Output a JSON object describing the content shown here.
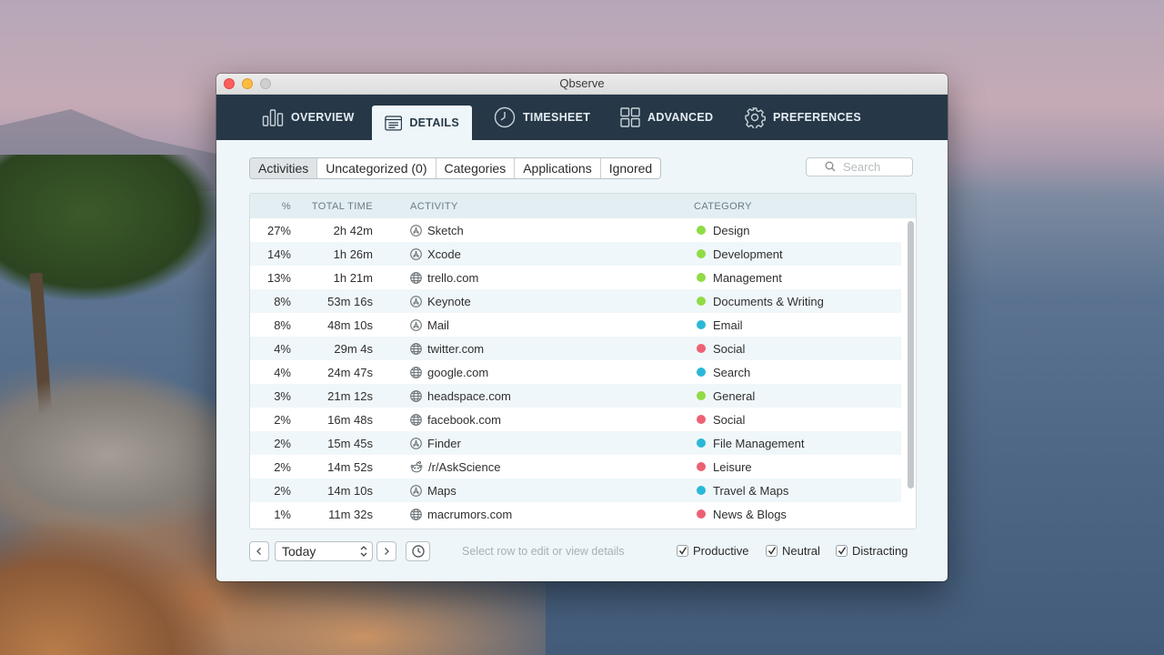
{
  "window": {
    "title": "Qbserve"
  },
  "tabs": [
    {
      "label": "OVERVIEW",
      "icon": "bar-chart-icon"
    },
    {
      "label": "DETAILS",
      "icon": "calendar-list-icon",
      "active": true
    },
    {
      "label": "TIMESHEET",
      "icon": "clock-icon"
    },
    {
      "label": "ADVANCED",
      "icon": "grid-icon"
    },
    {
      "label": "PREFERENCES",
      "icon": "gear-icon"
    }
  ],
  "filters": {
    "segments": [
      "Activities",
      "Uncategorized (0)",
      "Categories",
      "Applications",
      "Ignored"
    ],
    "selected": "Activities"
  },
  "search": {
    "placeholder": "Search",
    "value": ""
  },
  "table": {
    "headers": {
      "pct": "%",
      "time": "TOTAL TIME",
      "activity": "ACTIVITY",
      "category": "CATEGORY"
    },
    "rows": [
      {
        "pct": "27%",
        "time": "2h 42m",
        "activity": "Sketch",
        "icon": "app-store-icon",
        "category": "Design",
        "color": "#8fdc45"
      },
      {
        "pct": "14%",
        "time": "1h 26m",
        "activity": "Xcode",
        "icon": "app-store-icon",
        "category": "Development",
        "color": "#8fdc45"
      },
      {
        "pct": "13%",
        "time": "1h 21m",
        "activity": "trello.com",
        "icon": "globe-icon",
        "category": "Management",
        "color": "#8fdc45"
      },
      {
        "pct": "8%",
        "time": "53m 16s",
        "activity": "Keynote",
        "icon": "app-store-icon",
        "category": "Documents & Writing",
        "color": "#8fdc45"
      },
      {
        "pct": "8%",
        "time": "48m 10s",
        "activity": "Mail",
        "icon": "app-store-icon",
        "category": "Email",
        "color": "#2bb8d8"
      },
      {
        "pct": "4%",
        "time": "29m 4s",
        "activity": "twitter.com",
        "icon": "globe-icon",
        "category": "Social",
        "color": "#ec6274"
      },
      {
        "pct": "4%",
        "time": "24m 47s",
        "activity": "google.com",
        "icon": "globe-icon",
        "category": "Search",
        "color": "#2bb8d8"
      },
      {
        "pct": "3%",
        "time": "21m 12s",
        "activity": "headspace.com",
        "icon": "globe-icon",
        "category": "General",
        "color": "#8fdc45"
      },
      {
        "pct": "2%",
        "time": "16m 48s",
        "activity": "facebook.com",
        "icon": "globe-icon",
        "category": "Social",
        "color": "#ec6274"
      },
      {
        "pct": "2%",
        "time": "15m 45s",
        "activity": "Finder",
        "icon": "app-store-icon",
        "category": "File Management",
        "color": "#2bb8d8"
      },
      {
        "pct": "2%",
        "time": "14m 52s",
        "activity": "/r/AskScience",
        "icon": "reddit-icon",
        "category": "Leisure",
        "color": "#ec6274"
      },
      {
        "pct": "2%",
        "time": "14m 10s",
        "activity": "Maps",
        "icon": "app-store-icon",
        "category": "Travel & Maps",
        "color": "#2bb8d8"
      },
      {
        "pct": "1%",
        "time": "11m 32s",
        "activity": "macrumors.com",
        "icon": "globe-icon",
        "category": "News & Blogs",
        "color": "#ec6274"
      }
    ]
  },
  "footer": {
    "date_value": "Today",
    "hint": "Select row to edit or view details",
    "checks": [
      {
        "label": "Productive",
        "checked": true
      },
      {
        "label": "Neutral",
        "checked": true
      },
      {
        "label": "Distracting",
        "checked": true
      }
    ]
  }
}
